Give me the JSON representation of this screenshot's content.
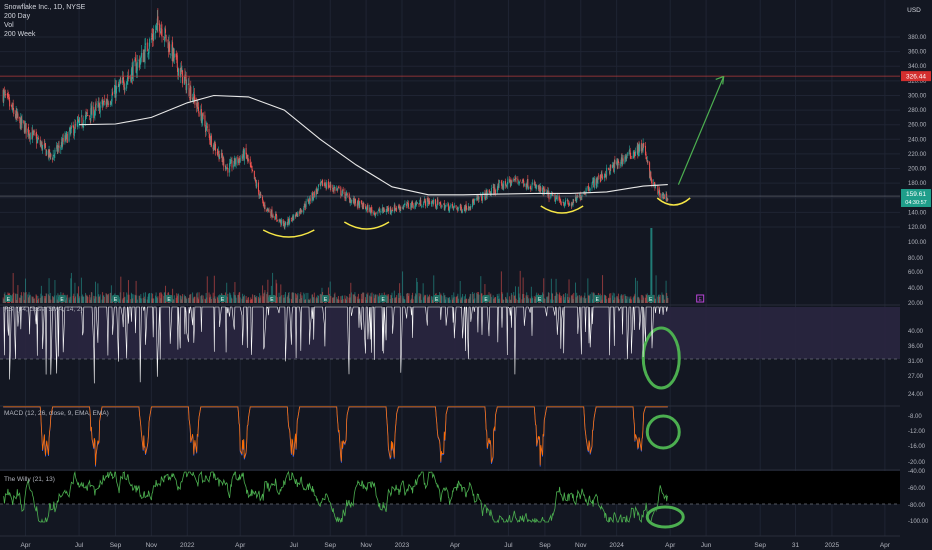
{
  "header": {
    "symbol_line": "Snowflake Inc., 1D, NYSE",
    "indicators": [
      "200 Day",
      "Vol",
      "200 Week"
    ],
    "currency": "USD"
  },
  "price_labels": {
    "target": "326.44",
    "last_price": "159.61",
    "countdown": "04:30:57"
  },
  "colors": {
    "background": "#131722",
    "up": "#26a69a",
    "down": "#ef5350",
    "ma_line": "#e8e8e8",
    "annotation_green": "#4caf50",
    "annotation_yellow": "#f6e646",
    "target_line": "#b23a3a",
    "rsi_band": "#2a2640",
    "rsi_line": "#ffffff",
    "macd_line": "#2962ff",
    "signal_line": "#ff6d00",
    "willy_line": "#4caf50",
    "willy_signal": "#ef5350"
  },
  "panels": {
    "rsi_label": "RSI (14, close, SMA, 14, 2)",
    "macd_label": "MACD (12, 26, close, 9, EMA, EMA)",
    "willy_label": "The Willy (21, 13)",
    "earnings_marker": "E"
  },
  "chart_data": [
    {
      "type": "candlestick",
      "title": "Snowflake Inc., 1D, NYSE",
      "y_axis_ticks": [
        380,
        360,
        340,
        320,
        300,
        280,
        260,
        240,
        220,
        200,
        180,
        160,
        140,
        120
      ],
      "ylim": [
        107,
        408
      ],
      "price_path": [
        {
          "date": "2021-02-20",
          "close": 305
        },
        {
          "date": "2021-03-20",
          "close": 265
        },
        {
          "date": "2021-04-15",
          "close": 244
        },
        {
          "date": "2021-05-15",
          "close": 215
        },
        {
          "date": "2021-06-15",
          "close": 248
        },
        {
          "date": "2021-07-15",
          "close": 272
        },
        {
          "date": "2021-08-15",
          "close": 290
        },
        {
          "date": "2021-09-15",
          "close": 318
        },
        {
          "date": "2021-10-15",
          "close": 350
        },
        {
          "date": "2021-11-15",
          "close": 400
        },
        {
          "date": "2021-12-15",
          "close": 340
        },
        {
          "date": "2022-01-10",
          "close": 300
        },
        {
          "date": "2022-02-10",
          "close": 240
        },
        {
          "date": "2022-03-10",
          "close": 200
        },
        {
          "date": "2022-04-10",
          "close": 220
        },
        {
          "date": "2022-05-10",
          "close": 150
        },
        {
          "date": "2022-06-15",
          "close": 122
        },
        {
          "date": "2022-07-15",
          "close": 145
        },
        {
          "date": "2022-08-20",
          "close": 180
        },
        {
          "date": "2022-09-15",
          "close": 170
        },
        {
          "date": "2022-10-10",
          "close": 155
        },
        {
          "date": "2022-11-15",
          "close": 140
        },
        {
          "date": "2022-12-15",
          "close": 145
        },
        {
          "date": "2023-01-15",
          "close": 150
        },
        {
          "date": "2023-02-15",
          "close": 155
        },
        {
          "date": "2023-03-15",
          "close": 148
        },
        {
          "date": "2023-04-15",
          "close": 145
        },
        {
          "date": "2023-05-15",
          "close": 160
        },
        {
          "date": "2023-06-15",
          "close": 175
        },
        {
          "date": "2023-07-15",
          "close": 185
        },
        {
          "date": "2023-08-15",
          "close": 175
        },
        {
          "date": "2023-09-15",
          "close": 160
        },
        {
          "date": "2023-10-15",
          "close": 150
        },
        {
          "date": "2023-11-15",
          "close": 175
        },
        {
          "date": "2023-12-15",
          "close": 195
        },
        {
          "date": "2024-01-15",
          "close": 215
        },
        {
          "date": "2024-02-15",
          "close": 230
        },
        {
          "date": "2024-03-01",
          "close": 180
        },
        {
          "date": "2024-03-15",
          "close": 165
        },
        {
          "date": "2024-03-28",
          "close": 159.61
        }
      ],
      "ma_200_path": [
        {
          "date": "2021-07-01",
          "value": 260
        },
        {
          "date": "2021-09-01",
          "value": 261
        },
        {
          "date": "2021-11-01",
          "value": 270
        },
        {
          "date": "2022-01-01",
          "value": 290
        },
        {
          "date": "2022-02-15",
          "value": 300
        },
        {
          "date": "2022-04-15",
          "value": 298
        },
        {
          "date": "2022-06-15",
          "value": 280
        },
        {
          "date": "2022-08-15",
          "value": 240
        },
        {
          "date": "2022-10-15",
          "value": 205
        },
        {
          "date": "2022-12-15",
          "value": 175
        },
        {
          "date": "2023-02-15",
          "value": 164
        },
        {
          "date": "2023-04-15",
          "value": 164
        },
        {
          "date": "2023-06-15",
          "value": 165
        },
        {
          "date": "2023-08-15",
          "value": 166
        },
        {
          "date": "2023-10-15",
          "value": 166
        },
        {
          "date": "2023-12-15",
          "value": 168
        },
        {
          "date": "2024-02-15",
          "value": 176
        },
        {
          "date": "2024-03-28",
          "value": 178
        }
      ],
      "horizontal_lines": [
        326.44,
        159.61
      ],
      "target_price": 326.44
    },
    {
      "type": "bar",
      "title": "Vol",
      "y_axis_ticks": [
        "100.00",
        "80.00",
        "60.00",
        "40.00",
        "20.00"
      ]
    },
    {
      "type": "line",
      "title": "RSI (14, close, SMA, 14, 2)",
      "y_axis_ticks": [
        "40.00",
        "36.00",
        "31.00",
        "27.00",
        "24.00"
      ]
    },
    {
      "type": "line",
      "title": "MACD (12, 26, close, 9, EMA, EMA)",
      "y_axis_ticks": [
        "-8.00",
        "-12.00",
        "-16.00",
        "-20.00"
      ]
    },
    {
      "type": "line",
      "title": "The Willy (21, 13)",
      "y_axis_ticks": [
        "-40.00",
        "-60.00",
        "-80.00",
        "-100.00"
      ]
    }
  ],
  "x_axis": {
    "labels": [
      "Apr",
      "Jul",
      "Sep",
      "Nov",
      "2022",
      "Apr",
      "Jul",
      "Sep",
      "Nov",
      "2023",
      "Apr",
      "Jul",
      "Sep",
      "Nov",
      "2024",
      "Apr",
      "Jun",
      "Sep",
      "31",
      "2025",
      "Apr"
    ],
    "dates": [
      "2021-04-01",
      "2021-07-01",
      "2021-09-01",
      "2021-11-01",
      "2022-01-01",
      "2022-04-01",
      "2022-07-01",
      "2022-09-01",
      "2022-11-01",
      "2023-01-01",
      "2023-04-01",
      "2023-07-01",
      "2023-09-01",
      "2023-11-01",
      "2024-01-01",
      "2024-04-01",
      "2024-06-01",
      "2024-09-01",
      "2024-10-31",
      "2025-01-01",
      "2025-04-01"
    ]
  }
}
